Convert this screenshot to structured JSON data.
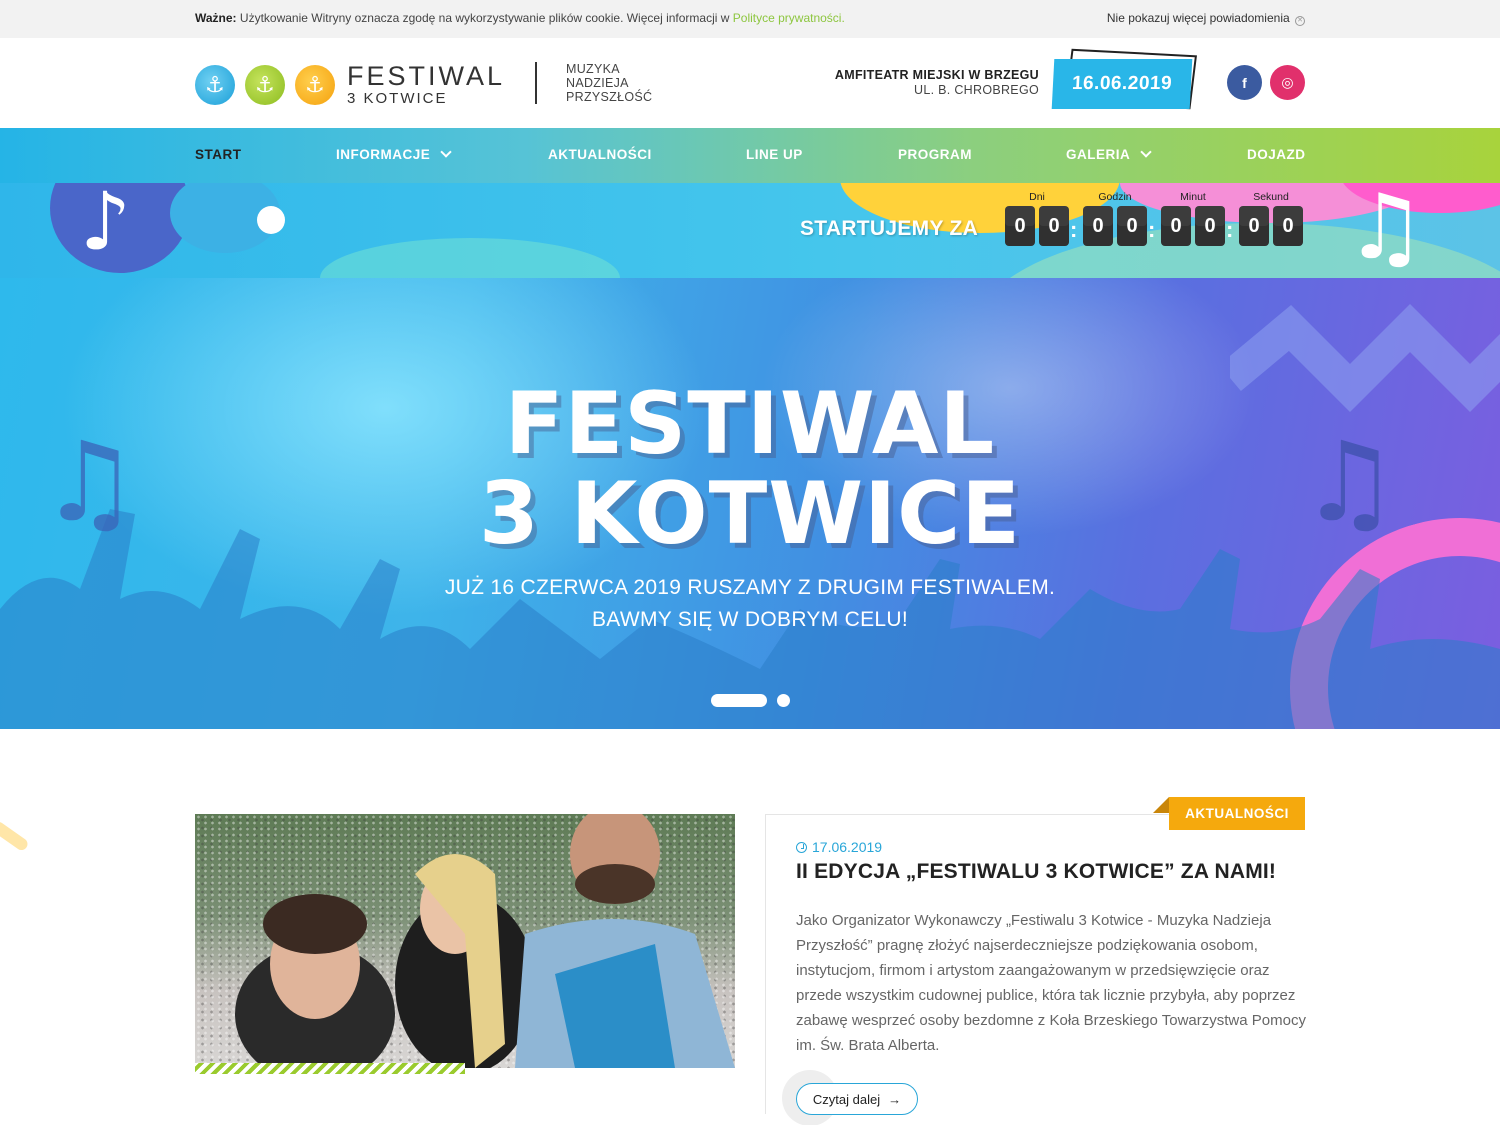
{
  "cookie_bar": {
    "important_label": "Ważne:",
    "message": "Użytkowanie Witryny oznacza zgodę na wykorzystywanie plików cookie. Więcej informacji w",
    "policy_link": "Polityce prywatności.",
    "dismiss_label": "Nie pokazuj więcej powiadomienia",
    "dismiss_icon": "⊗"
  },
  "header": {
    "logo_line1": "FESTIWAL",
    "logo_line2": "3 KOTWICE",
    "anchor_icon": "⚓",
    "tagline": [
      "MUZYKA",
      "NADZIEJA",
      "PRZYSZŁOŚĆ"
    ],
    "venue_name": "AMFITEATR MIEJSKI W BRZEGU",
    "venue_address": "UL. B. CHROBREGO",
    "date": "16.06.2019",
    "social": {
      "facebook": "f",
      "instagram": "◎"
    }
  },
  "nav": {
    "items": [
      {
        "label": "START",
        "active": true
      },
      {
        "label": "INFORMACJE",
        "dropdown": true
      },
      {
        "label": "AKTUALNOŚCI"
      },
      {
        "label": "LINE UP"
      },
      {
        "label": "PROGRAM"
      },
      {
        "label": "GALERIA",
        "dropdown": true
      },
      {
        "label": "DOJAZD"
      }
    ]
  },
  "countdown": {
    "label": "STARTUJEMY ZA",
    "units": [
      {
        "label": "Dni",
        "digits": [
          "0",
          "0"
        ]
      },
      {
        "label": "Godzin",
        "digits": [
          "0",
          "0"
        ]
      },
      {
        "label": "Minut",
        "digits": [
          "0",
          "0"
        ]
      },
      {
        "label": "Sekund",
        "digits": [
          "0",
          "0"
        ]
      }
    ],
    "separator": ":",
    "note_single": "♪",
    "note_double": "♫"
  },
  "hero": {
    "title_line1": "FESTIWAL",
    "title_line2": "3 KOTWICE",
    "subtitle_line1": "JUŻ 16 CZERWCA 2019 RUSZAMY Z DRUGIM FESTIWALEM.",
    "subtitle_line2": "BAWMY SIĘ W DOBRYM CELU!",
    "slides": 2,
    "active_slide": 1
  },
  "news": {
    "category": "AKTUALNOŚCI",
    "date": "17.06.2019",
    "title": "II EDYCJA „FESTIWALU 3 KOTWICE” ZA NAMI!",
    "body": "Jako Organizator Wykonawczy „Festiwalu 3 Kotwice - Muzyka Nadzieja Przyszłość” pragnę złożyć najserdeczniejsze podziękowania osobom, instytucjom, firmom i artystom zaangażowanym w przedsięwzięcie oraz przede wszystkim cudownej publice, która tak licznie przybyła, aby poprzez zabawę wesprzeć osoby bezdomne z Koła Brzeskiego Towarzystwa Pomocy im. Św. Brata Alberta.",
    "read_more": "Czytaj dalej",
    "read_more_icon": "→"
  },
  "colors": {
    "accent_blue": "#29b6e8",
    "accent_green": "#a8d33c",
    "accent_orange": "#f5a90d",
    "accent_pink": "#f06fd6",
    "facebook": "#3b5ba0",
    "instagram": "#e1306c"
  }
}
